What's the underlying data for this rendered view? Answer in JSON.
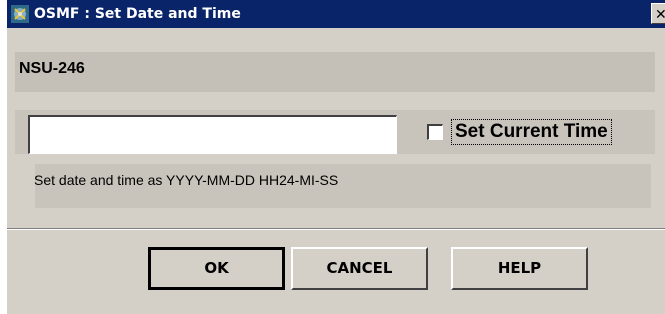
{
  "window": {
    "title": "OSMF : Set Date and Time",
    "close_glyph": "✕",
    "icon": "osmf-app-icon"
  },
  "node": {
    "name": "NSU-246"
  },
  "datetime": {
    "value": "",
    "placeholder": ""
  },
  "set_current_time": {
    "label": "Set Current Time",
    "checked": false
  },
  "hint": {
    "text": "Set date and time as YYYY-MM-DD HH24-MI-SS"
  },
  "buttons": {
    "ok": "OK",
    "cancel": "CANCEL",
    "help": "HELP"
  },
  "colors": {
    "titlebar": "#0a246a",
    "dialog_bg": "#d4d0c8"
  }
}
